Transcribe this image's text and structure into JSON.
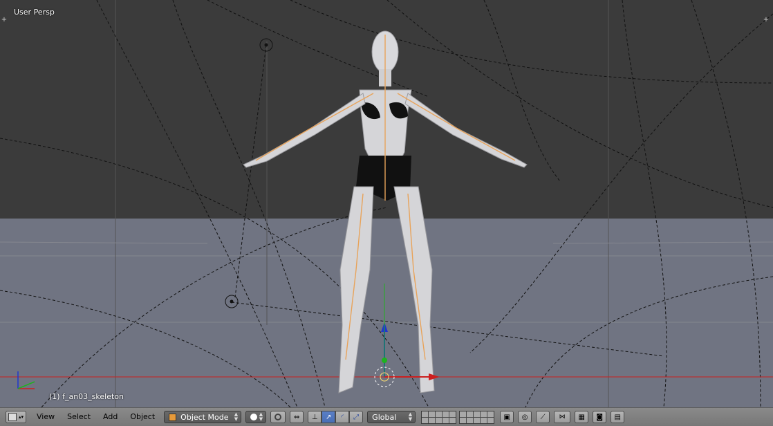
{
  "viewport": {
    "view_name": "User Persp",
    "object_info": "(1) f_an03_skeleton",
    "sky_color": "#3b3b3b",
    "ground_color": "#707482",
    "bone_color": "#e8a35a",
    "x_axis_color": "#cc1f1f",
    "z_axis_color": "#1f37cc",
    "y_axis_color": "#1fb21f"
  },
  "header": {
    "editor_type_icon": "3d-view-cube-icon",
    "menus": [
      "View",
      "Select",
      "Add",
      "Object"
    ],
    "mode": "Object Mode",
    "mode_icon": "object-mode-cube-icon",
    "shading_icon": "solid-sphere-icon",
    "pivot_icon": "pivot-point-icon",
    "manipulator_icon": "manipulator-icon",
    "orientation": "Global",
    "snap_icons": [
      "snap-magnet-icon",
      "proportional-edit-icon",
      "onion-icon",
      "render-icon",
      "camera-icon",
      "clapper-icon"
    ]
  }
}
